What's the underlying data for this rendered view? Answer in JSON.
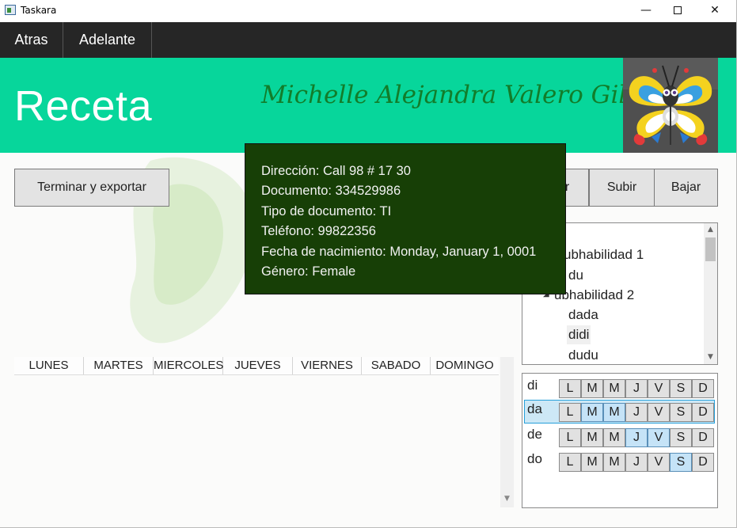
{
  "window": {
    "title": "Taskara",
    "minimize_glyph": "—",
    "close_glyph": "✕"
  },
  "nav": {
    "back_label": "Atras",
    "forward_label": "Adelante"
  },
  "header": {
    "page_title": "Receta",
    "user_name": "Michelle Alejandra Valero Gil",
    "accent_color": "#07d69b"
  },
  "toolbar": {
    "export_label": "Terminar y exportar",
    "mover_label_visible": "ar",
    "subir_label": "Subir",
    "bajar_label": "Bajar"
  },
  "tree": {
    "items": [
      {
        "label": "Subhabilidad 1",
        "visible_text": "ubhabilidad 1"
      },
      {
        "label": "du"
      },
      {
        "label": "Subhabilidad 2",
        "visible_text": "ubhabilidad 2"
      },
      {
        "label": "dada"
      },
      {
        "label": "didi"
      },
      {
        "label": "dudu"
      }
    ]
  },
  "week": {
    "days": [
      "LUNES",
      "MARTES",
      "MIERCOLES",
      "JUEVES",
      "VIERNES",
      "SABADO",
      "DOMINGO"
    ]
  },
  "habits": {
    "day_letters": [
      "L",
      "M",
      "M",
      "J",
      "V",
      "S",
      "D"
    ],
    "rows": [
      {
        "label": "di",
        "selected": false,
        "active": [
          false,
          false,
          false,
          false,
          false,
          false,
          false
        ]
      },
      {
        "label": "da",
        "selected": true,
        "active": [
          false,
          true,
          true,
          false,
          false,
          false,
          false
        ]
      },
      {
        "label": "de",
        "selected": false,
        "active": [
          false,
          false,
          false,
          true,
          true,
          false,
          false
        ]
      },
      {
        "label": "do",
        "selected": false,
        "active": [
          false,
          false,
          false,
          false,
          false,
          true,
          false
        ]
      }
    ]
  },
  "tooltip": {
    "lines": [
      "Dirección: Call 98 # 17 30",
      "Documento: 334529986",
      "Tipo de documento: TI",
      "Teléfono: 99822356",
      "Fecha de nacimiento: Monday, January 1, 0001",
      "Género: Female"
    ],
    "background": "#173f06"
  }
}
